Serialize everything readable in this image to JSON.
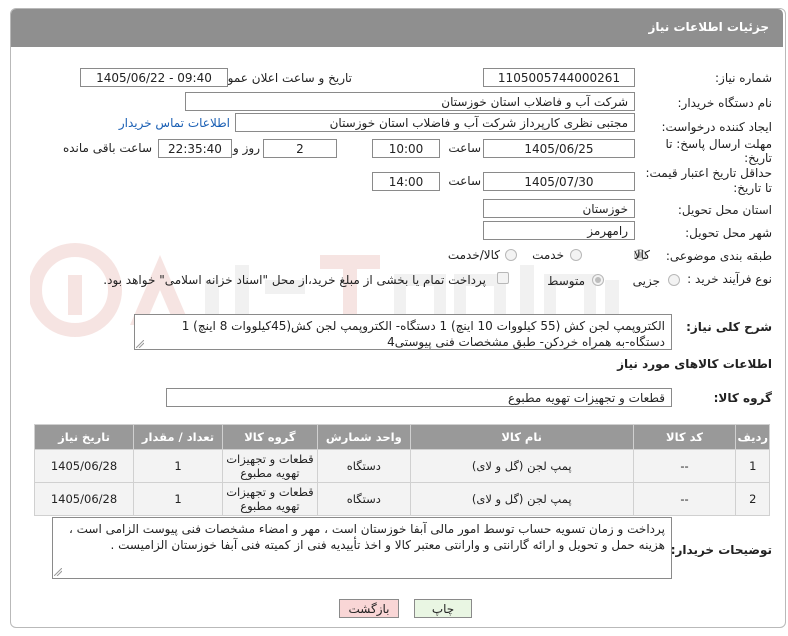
{
  "header": {
    "title": "جزئیات اطلاعات نیاز"
  },
  "form": {
    "need_number_label": "شماره نیاز:",
    "need_number": "1105005744000261",
    "announce_label": "تاریخ و ساعت اعلان عمومی:",
    "announce_value": "1405/06/22 - 09:40",
    "buyer_org_label": "نام دستگاه خریدار:",
    "buyer_org": "شرکت آب و فاضلاب استان خوزستان",
    "creator_label": "ایجاد کننده درخواست:",
    "creator": "مجتبی نظری کارپرداز شرکت آب و فاضلاب استان خوزستان",
    "contact_link": "اطلاعات تماس خریدار",
    "deadline_label_1": "مهلت ارسال پاسخ: تا",
    "deadline_label_2": "تاریخ:",
    "deadline_date": "1405/06/25",
    "time_label": "ساعت",
    "deadline_time": "10:00",
    "days_value": "2",
    "days_label": "روز و",
    "remaining_time": "22:35:40",
    "remaining_label": "ساعت باقی مانده",
    "validity_label_1": "حداقل تاریخ اعتبار قیمت:",
    "validity_label_2": "تا تاریخ:",
    "validity_date": "1405/07/30",
    "validity_time": "14:00",
    "province_label": "استان محل تحویل:",
    "province": "خوزستان",
    "city_label": "شهر محل تحویل:",
    "city": "رامهرمز",
    "category_label": "طبقه بندی موضوعی:",
    "category_options": [
      "کالا",
      "خدمت",
      "کالا/خدمت"
    ],
    "process_label": "نوع فرآیند خرید :",
    "process_options": [
      "جزیی",
      "متوسط"
    ],
    "payment_note": "پرداخت تمام یا بخشی از مبلغ خرید،از محل \"اسناد خزانه اسلامی\" خواهد بود."
  },
  "description": {
    "label": "شرح کلی نیاز:",
    "text": "الکتروپمپ لجن کش (55 کیلووات 10 اینچ) 1 دستگاه- الکتروپمپ لجن کش(45کیلووات 8 اینچ) 1 دستگاه-به همراه خردکن- طبق مشخصات فنی پیوستی4"
  },
  "goods": {
    "section_title": "اطلاعات کالاهای مورد نیاز",
    "group_label": "گروه کالا:",
    "group_value": "قطعات و تجهیزات تهویه مطبوع",
    "columns": [
      "ردیف",
      "کد کالا",
      "نام کالا",
      "واحد شمارش",
      "گروه کالا",
      "تعداد / مقدار",
      "تاریخ نیاز"
    ],
    "rows": [
      [
        "1",
        "--",
        "پمپ لجن (گل و لای)",
        "دستگاه",
        "قطعات و تجهیزات تهویه مطبوع",
        "1",
        "1405/06/28"
      ],
      [
        "2",
        "--",
        "پمپ لجن (گل و لای)",
        "دستگاه",
        "قطعات و تجهیزات تهویه مطبوع",
        "1",
        "1405/06/28"
      ]
    ]
  },
  "buyer_notes": {
    "label": "توضیحات خریدار:",
    "text": "پرداخت و زمان تسویه حساب توسط امور مالی آبفا خوزستان است ، مهر و امضاء مشخصات فنی پیوست الزامی است ، هزینه حمل و تحویل و ارائه گارانتی و وارانتی معتبر کالا و اخذ تأییدیه فنی از کمیته فنی آبفا خوزستان الزامیست ."
  },
  "buttons": {
    "print": "چاپ",
    "back": "بازگشت"
  },
  "colors": {
    "title_bar": "#8f8f8f",
    "table_header": "#999999",
    "link": "#1a5fb4",
    "back_button": "#f9d6d6",
    "print_button": "#e9f6e3"
  }
}
